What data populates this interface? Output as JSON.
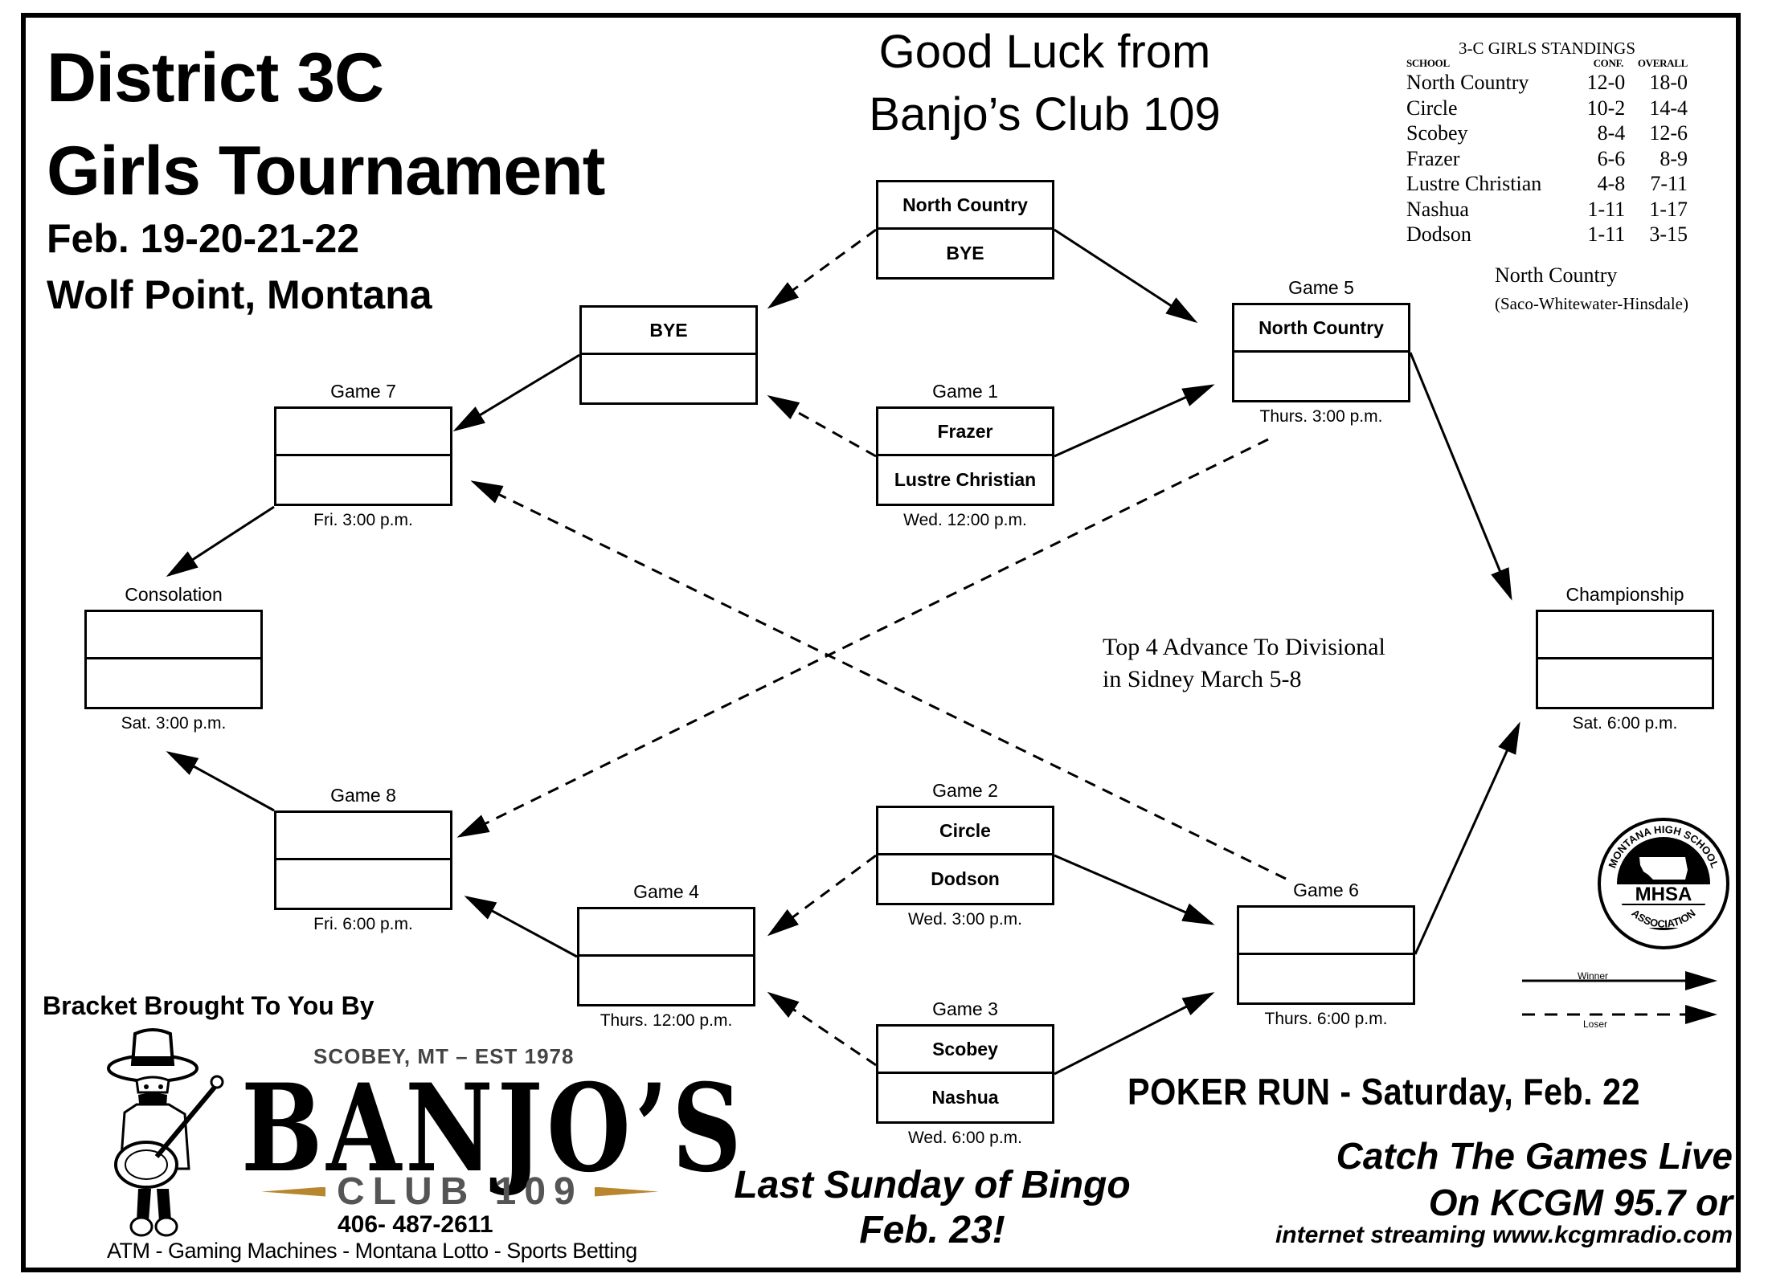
{
  "header": {
    "title_line1": "District 3C",
    "title_line2": "Girls Tournament",
    "dates": "Feb. 19-20-21-22",
    "location": "Wolf Point, Montana",
    "good_luck_line1": "Good Luck from",
    "good_luck_line2": "Banjo’s Club 109"
  },
  "standings": {
    "title": "3-C GIRLS STANDINGS",
    "columns": [
      "SCHOOL",
      "CONF.",
      "OVERALL"
    ],
    "rows": [
      {
        "school": "North Country",
        "conf": "12-0",
        "overall": "18-0"
      },
      {
        "school": "Circle",
        "conf": "10-2",
        "overall": "14-4"
      },
      {
        "school": "Scobey",
        "conf": "8-4",
        "overall": "12-6"
      },
      {
        "school": "Frazer",
        "conf": "6-6",
        "overall": "8-9"
      },
      {
        "school": "Lustre Christian",
        "conf": "4-8",
        "overall": "7-11"
      },
      {
        "school": "Nashua",
        "conf": "1-11",
        "overall": "1-17"
      },
      {
        "school": "Dodson",
        "conf": "1-11",
        "overall": "3-15"
      }
    ],
    "note_team": "North Country",
    "note_detail": "(Saco-Whitewater-Hinsdale)"
  },
  "bracket": {
    "games": [
      {
        "id": "seed",
        "label": "",
        "top": "North Country",
        "bottom": "BYE",
        "time": ""
      },
      {
        "id": "bye",
        "label": "",
        "top": "BYE",
        "bottom": "",
        "time": ""
      },
      {
        "id": "game1",
        "label": "Game 1",
        "top": "Frazer",
        "bottom": "Lustre Christian",
        "time": "Wed. 12:00 p.m."
      },
      {
        "id": "game2",
        "label": "Game 2",
        "top": "Circle",
        "bottom": "Dodson",
        "time": "Wed. 3:00 p.m."
      },
      {
        "id": "game3",
        "label": "Game 3",
        "top": "Scobey",
        "bottom": "Nashua",
        "time": "Wed. 6:00  p.m."
      },
      {
        "id": "game4",
        "label": "Game 4",
        "top": "",
        "bottom": "",
        "time": "Thurs. 12:00 p.m."
      },
      {
        "id": "game5",
        "label": "Game 5",
        "top": "North Country",
        "bottom": "",
        "time": "Thurs. 3:00 p.m."
      },
      {
        "id": "game6",
        "label": "Game 6",
        "top": "",
        "bottom": "",
        "time": "Thurs. 6:00 p.m."
      },
      {
        "id": "game7",
        "label": "Game 7",
        "top": "",
        "bottom": "",
        "time": "Fri. 3:00 p.m."
      },
      {
        "id": "game8",
        "label": "Game 8",
        "top": "",
        "bottom": "",
        "time": "Fri. 6:00 p.m."
      },
      {
        "id": "consolation",
        "label": "Consolation",
        "top": "",
        "bottom": "",
        "time": "Sat. 3:00 p.m."
      },
      {
        "id": "championship",
        "label": "Championship",
        "top": "",
        "bottom": "",
        "time": "Sat. 6:00 p.m."
      }
    ],
    "connections": [
      {
        "from": "seed",
        "to": "bye",
        "type": "loser"
      },
      {
        "from": "seed",
        "to": "game5",
        "type": "winner"
      },
      {
        "from": "game1",
        "to": "bye",
        "type": "loser"
      },
      {
        "from": "game1",
        "to": "game5",
        "type": "winner"
      },
      {
        "from": "bye",
        "to": "game7",
        "type": "winner"
      },
      {
        "from": "game7",
        "to": "consolation",
        "type": "winner"
      },
      {
        "from": "game5",
        "to": "championship",
        "type": "winner"
      },
      {
        "from": "game5",
        "to": "game8",
        "type": "loser"
      },
      {
        "from": "game6",
        "to": "game7",
        "type": "loser"
      },
      {
        "from": "game8",
        "to": "consolation",
        "type": "winner"
      },
      {
        "from": "game4",
        "to": "game8",
        "type": "winner"
      },
      {
        "from": "game2",
        "to": "game4",
        "type": "loser"
      },
      {
        "from": "game2",
        "to": "game6",
        "type": "winner"
      },
      {
        "from": "game3",
        "to": "game4",
        "type": "loser"
      },
      {
        "from": "game3",
        "to": "game6",
        "type": "winner"
      },
      {
        "from": "game6",
        "to": "championship",
        "type": "winner"
      }
    ],
    "advance_note_line1": "Top  4 Advance To Divisional",
    "advance_note_line2": "in Sidney March 5-8"
  },
  "legend": {
    "winner": "Winner",
    "loser": "Loser"
  },
  "logo": {
    "org_top": "MONTANA HIGH SCHOOL",
    "org_abbrev": "MHSA",
    "org_bottom": "ASSOCIATION"
  },
  "sponsor": {
    "header": "Bracket Brought To You By",
    "tagline": "SCOBEY, MT – EST 1978",
    "name": "BANJO’S",
    "club": "CLUB 109",
    "phone": "406- 487-2611",
    "services": "ATM - Gaming Machines - Montana Lotto -  Sports Betting",
    "accent_color": "#b8862f"
  },
  "promos": {
    "bingo_line1": "Last Sunday of Bingo",
    "bingo_line2": "Feb. 23!",
    "poker_run": "POKER RUN - Saturday, Feb. 22",
    "radio_line1": "Catch The Games Live",
    "radio_line2": "On KCGM 95.7 or",
    "radio_line3": "internet streaming  www.kcgmradio.com"
  }
}
